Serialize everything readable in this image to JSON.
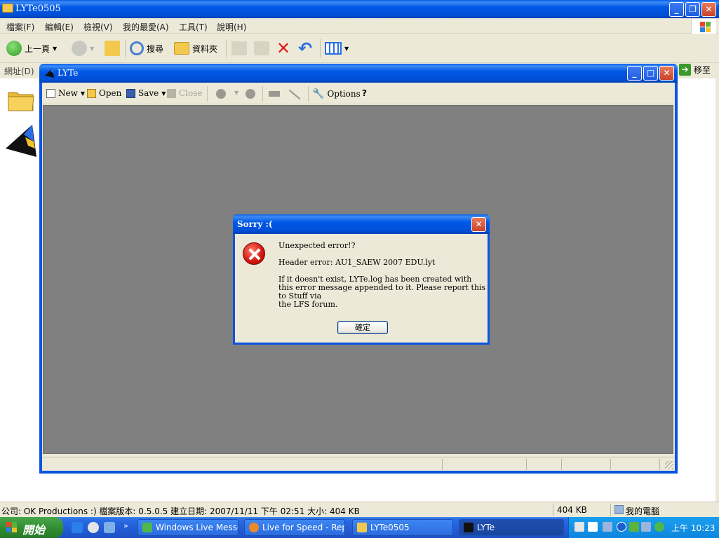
{
  "explorer": {
    "title": "LYTe0505",
    "menu": [
      "檔案(F)",
      "編輯(E)",
      "檢視(V)",
      "我的最愛(A)",
      "工具(T)",
      "說明(H)"
    ],
    "toolbar": {
      "back_label": "上一頁",
      "search_label": "搜尋",
      "folders_label": "資料夾"
    },
    "address_label": "網址(D)",
    "go_label": "移至",
    "status": {
      "details": "公司: OK Productions :) 檔案版本: 0.5.0.5 建立日期: 2007/11/11 下午 02:51 大小: 404 KB",
      "size": "404 KB",
      "zone": "我的電腦"
    }
  },
  "lyte": {
    "title": "LYTe",
    "toolbar": {
      "new_label": "New",
      "open_label": "Open",
      "save_label": "Save",
      "close_label": "Close",
      "options_label": "Options",
      "help_label": "?"
    }
  },
  "dialog": {
    "title": "Sorry :(",
    "line1": "Unexpected error!?",
    "line2": "Header error: AU1_SAEW 2007 EDU.lyt",
    "line3a": "If it doesn't exist, LYTe.log has been created with",
    "line3b": "this error message appended to it. Please report this to Stuff via",
    "line3c": "the LFS forum.",
    "ok_label": "確定"
  },
  "taskbar": {
    "start_label": "開始",
    "tasks": [
      {
        "label": "Windows Live Messe..."
      },
      {
        "label": "Live for Speed - Rep..."
      },
      {
        "label": "LYTe0505"
      },
      {
        "label": "LYTe"
      }
    ],
    "clock": "上午 10:23"
  },
  "colors": {
    "xp_blue": "#0058e6",
    "canvas_grey": "#808080",
    "error_red": "#d0150d",
    "window_face": "#ece9d8"
  }
}
